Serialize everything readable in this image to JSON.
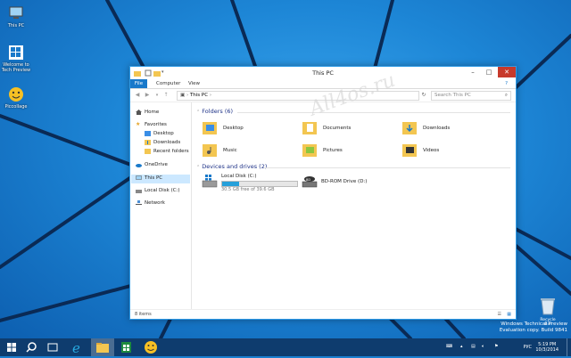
{
  "desktop": {
    "icons": [
      {
        "label": "This PC"
      },
      {
        "label": "Welcome to Tech Preview"
      },
      {
        "label": "Piccollage"
      }
    ],
    "recycle_label": "Recycle Bin",
    "watermark": "All4os.ru",
    "info_line1": "Windows Technical Preview",
    "info_line2": "Evaluation copy. Build 9841"
  },
  "window": {
    "title": "This PC",
    "ribbon_tabs": [
      "File",
      "Computer",
      "View"
    ],
    "address_path": "This PC",
    "search_placeholder": "Search This PC",
    "nav": {
      "home": "Home",
      "favorites": "Favorites",
      "desktop": "Desktop",
      "downloads": "Downloads",
      "recent": "Recent folders",
      "onedrive": "OneDrive",
      "this_pc": "This PC",
      "local_disk": "Local Disk (C:)",
      "network": "Network"
    },
    "folders_header": "Folders (6)",
    "folders": [
      {
        "label": "Desktop"
      },
      {
        "label": "Documents"
      },
      {
        "label": "Downloads"
      },
      {
        "label": "Music"
      },
      {
        "label": "Pictures"
      },
      {
        "label": "Videos"
      }
    ],
    "drives_header": "Devices and drives (2)",
    "drives": [
      {
        "label": "Local Disk (C:)",
        "free": "30.5 GB free of 39.6 GB",
        "used_fraction": 0.23
      },
      {
        "label": "BD-ROM Drive (D:)"
      }
    ],
    "status": "8 items"
  },
  "taskbar": {
    "lang": "РУС",
    "time": "5:19 PM",
    "date": "10/3/2014"
  },
  "colors": {
    "accent": "#1979ca",
    "close": "#c7392b",
    "header_text": "#1e3287",
    "taskbar": "#0e3c6e"
  }
}
